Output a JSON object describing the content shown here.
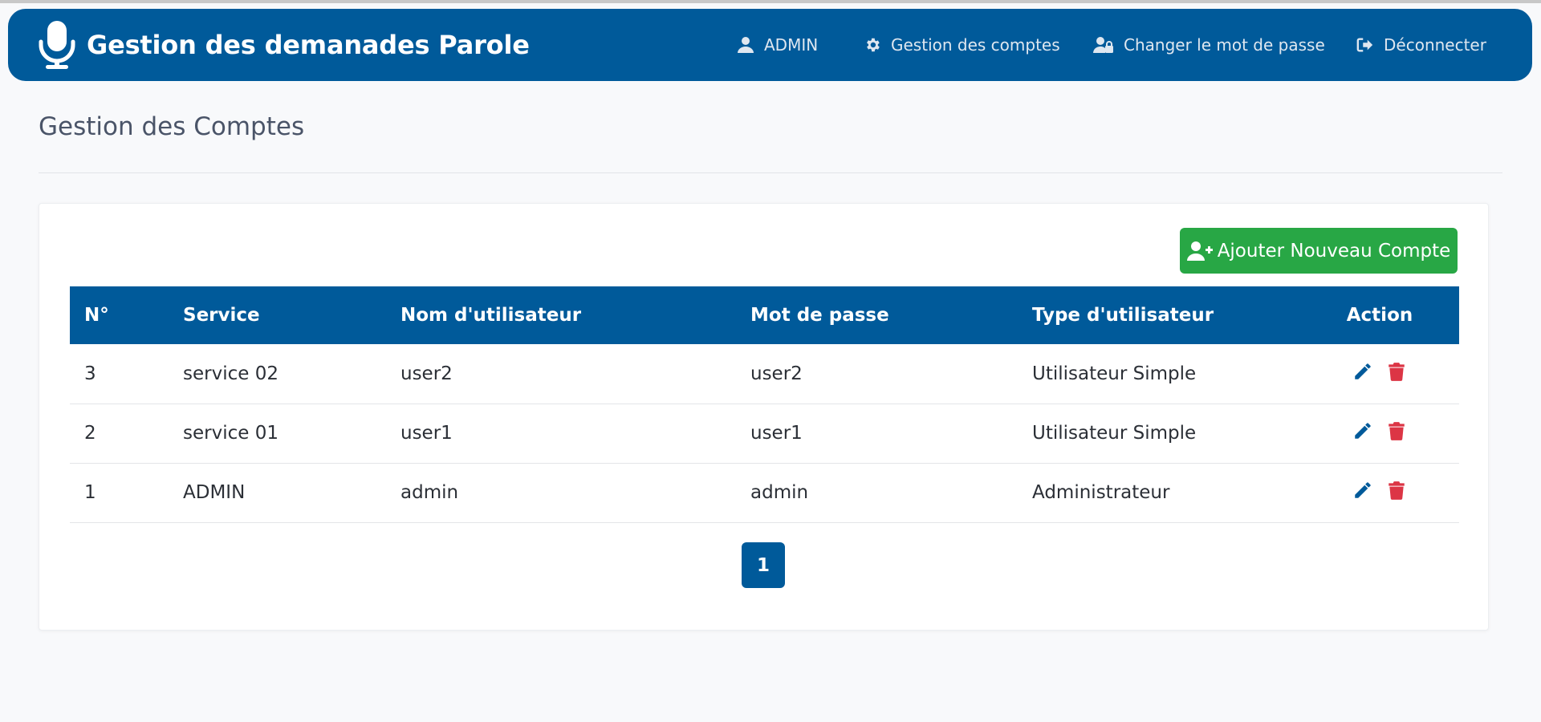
{
  "navbar": {
    "brand_title": "Gestion des demanades Parole",
    "brand_icon": "microphone-icon",
    "items": [
      {
        "label": "ADMIN",
        "icon": "user-icon"
      },
      {
        "label": "Gestion des comptes",
        "icon": "gear-icon"
      },
      {
        "label": "Changer le mot de passe",
        "icon": "user-lock-icon"
      },
      {
        "label": "Déconnecter",
        "icon": "sign-out-icon"
      }
    ]
  },
  "page": {
    "title": "Gestion des Comptes"
  },
  "toolbar": {
    "add_label": "Ajouter Nouveau Compte",
    "add_icon": "user-plus-icon"
  },
  "table": {
    "headers": [
      "N°",
      "Service",
      "Nom d'utilisateur",
      "Mot de passe",
      "Type d'utilisateur",
      "Action"
    ],
    "rows": [
      {
        "num": "3",
        "service": "service 02",
        "username": "user2",
        "password": "user2",
        "type": "Utilisateur Simple"
      },
      {
        "num": "2",
        "service": "service 01",
        "username": "user1",
        "password": "user1",
        "type": "Utilisateur Simple"
      },
      {
        "num": "1",
        "service": "ADMIN",
        "username": "admin",
        "password": "admin",
        "type": "Administrateur"
      }
    ]
  },
  "pagination": {
    "current_page": "1"
  },
  "colors": {
    "primary": "#005a9a",
    "success": "#28a745",
    "danger": "#dc3545",
    "background": "#f8f9fb"
  }
}
